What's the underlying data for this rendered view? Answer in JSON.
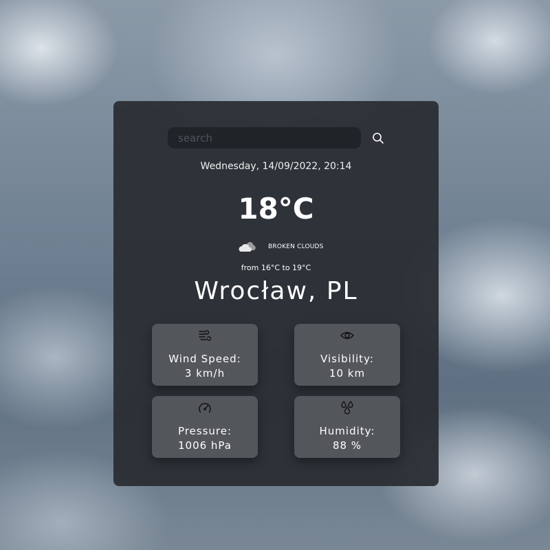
{
  "search": {
    "placeholder": "search",
    "value": ""
  },
  "icons": {
    "search": "search-icon",
    "weather": "broken-clouds-icon",
    "wind": "wind-icon",
    "visibility": "eye-icon",
    "pressure": "gauge-icon",
    "humidity": "droplets-icon"
  },
  "weather": {
    "datetime": "Wednesday, 14/09/2022, 20:14",
    "temperature": "18°C",
    "description": "broken clouds",
    "range": "from 16°C to 19°C",
    "location": "Wrocław, PL"
  },
  "details": {
    "wind": {
      "label": "Wind Speed:",
      "value": "3 km/h"
    },
    "visibility": {
      "label": "Visibility:",
      "value": "10 km"
    },
    "pressure": {
      "label": "Pressure:",
      "value": "1006 hPa"
    },
    "humidity": {
      "label": "Humidity:",
      "value": "88 %"
    }
  },
  "colors": {
    "card": "#282b31",
    "tile": "#53565b",
    "input": "#202328",
    "text": "#ffffff"
  }
}
